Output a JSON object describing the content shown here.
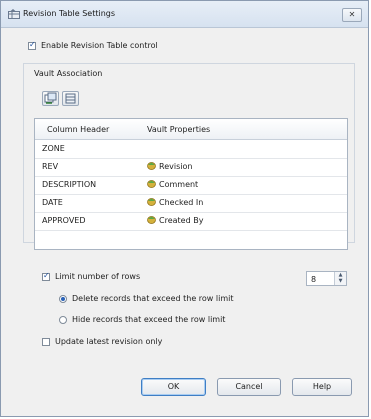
{
  "window": {
    "title": "Revision Table Settings",
    "close_label": "✕"
  },
  "enable_control": {
    "label": "Enable Revision Table control",
    "checked": true
  },
  "vault_association": {
    "group_label": "Vault Association",
    "table": {
      "headers": [
        "Column Header",
        "Vault Properties"
      ],
      "rows": [
        {
          "column_header": "ZONE",
          "vault_property": ""
        },
        {
          "column_header": "REV",
          "vault_property": "Revision"
        },
        {
          "column_header": "DESCRIPTION",
          "vault_property": "Comment"
        },
        {
          "column_header": "DATE",
          "vault_property": "Checked In"
        },
        {
          "column_header": "APPROVED",
          "vault_property": "Created By"
        }
      ]
    }
  },
  "limit_rows": {
    "label": "Limit number of rows",
    "checked": true,
    "value": "8",
    "options": [
      {
        "label": "Delete records that exceed the row limit",
        "selected": true
      },
      {
        "label": "Hide records that exceed the row limit",
        "selected": false
      }
    ]
  },
  "update_latest": {
    "label": "Update latest revision only",
    "checked": false
  },
  "buttons": {
    "ok": "OK",
    "cancel": "Cancel",
    "help": "Help"
  }
}
